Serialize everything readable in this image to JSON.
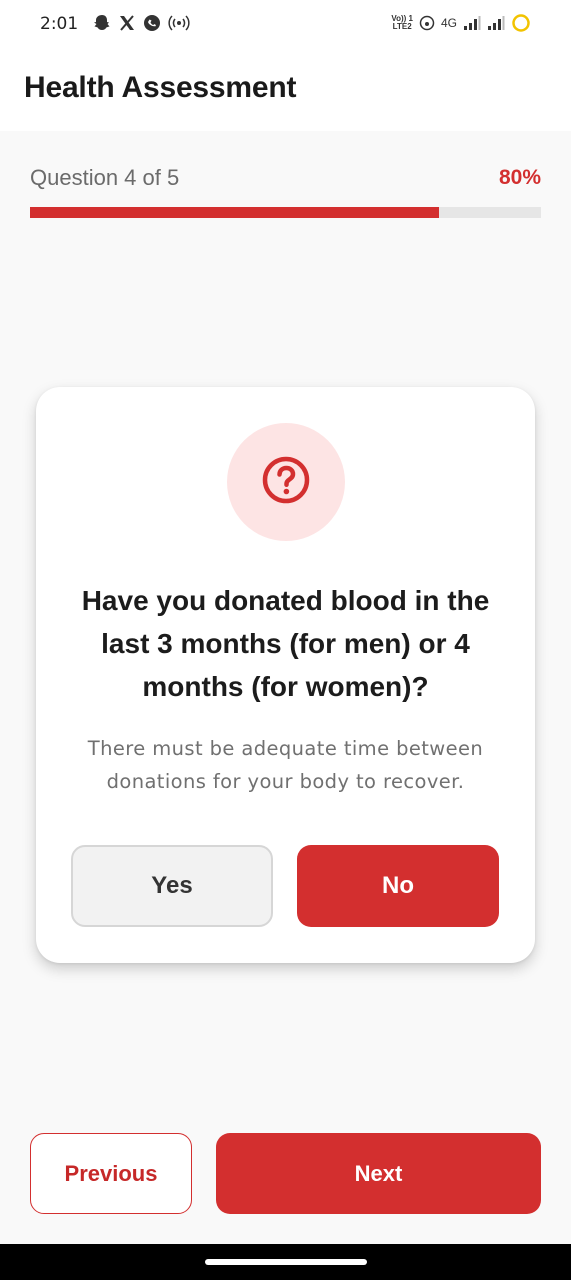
{
  "status_bar": {
    "time": "2:01",
    "left_icons": [
      "snapchat-icon",
      "x-icon",
      "chat-icon",
      "hotspot-icon"
    ],
    "volte_label_top": "Vo)) 1",
    "volte_label_bottom": "LTE2",
    "network": "4G",
    "right_icons": [
      "wifi-calling-icon",
      "signal-icon",
      "signal-icon",
      "battery-ring-icon"
    ]
  },
  "app_bar": {
    "title": "Health Assessment"
  },
  "progress": {
    "label": "Question 4 of 5",
    "percent_text": "80%",
    "value": 0.8,
    "color": "#d32f2f"
  },
  "question": {
    "icon": "help-circle-icon",
    "title": "Have you donated blood in the last 3 months (for men) or 4 months (for women)?",
    "description": "There must be adequate time between donations for your body to recover.",
    "options": {
      "yes": "Yes",
      "no": "No"
    },
    "selected": "No"
  },
  "navigation": {
    "previous": "Previous",
    "next": "Next"
  },
  "colors": {
    "accent": "#d32f2f",
    "accent_light": "#fde4e4"
  }
}
